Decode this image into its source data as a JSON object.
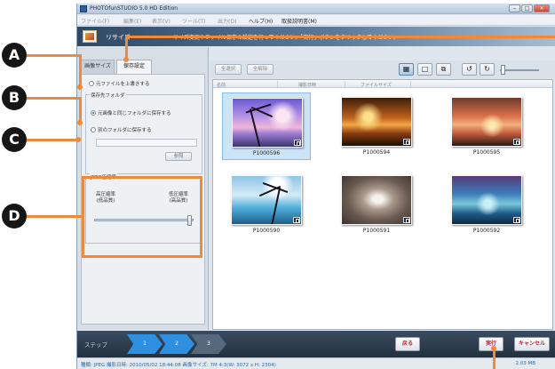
{
  "window": {
    "title": "PHOTOfunSTUDIO 5.0 HD Edition",
    "controls": [
      "–",
      "□",
      "×"
    ]
  },
  "menu": [
    {
      "label": "ファイル(F)",
      "active": false
    },
    {
      "label": "編集(E)",
      "active": false
    },
    {
      "label": "表示(V)",
      "active": false
    },
    {
      "label": "ツール(T)",
      "active": false
    },
    {
      "label": "出力(O)",
      "active": false
    },
    {
      "label": "ヘルプ(H)",
      "active": true
    },
    {
      "label": "取扱説明書(M)",
      "active": true
    }
  ],
  "header": {
    "title": "リサイズ",
    "description": "サイズ変更やファイル保存の設定を行ってください。「実行」ボタンをクリックしてください。"
  },
  "left_panel": {
    "tabs": [
      {
        "label": "画像サイズ",
        "selected": false
      },
      {
        "label": "保存設定",
        "selected": true
      }
    ],
    "overwrite_label": "元ファイルを上書きする",
    "save_folder_group": "保存先フォルダ",
    "same_folder_label": "元画像と同じフォルダに保存する",
    "other_folder_label": "別のフォルダに保存する",
    "browse_label": "参照",
    "jpeg_group": "JPEG圧縮率",
    "high_compression": "高圧縮率\n(低品質)",
    "low_compression": "低圧縮率\n(高品質)",
    "jpeg_slider_value_fraction": 0.96
  },
  "toolbar": {
    "select_all": "全選択",
    "deselect_all": "全解除",
    "view_buttons": [
      "▦",
      "□",
      "⧉"
    ],
    "rotate_buttons": [
      "↺",
      "↻"
    ],
    "zoom_slider_fraction": 0.1
  },
  "grid": {
    "columns": [
      "名前",
      "撮影日時",
      "ファイルサイズ"
    ],
    "files": [
      {
        "name": "P1000596",
        "selected": true
      },
      {
        "name": "P1000594",
        "selected": false
      },
      {
        "name": "P1000595",
        "selected": false
      },
      {
        "name": "P1000590",
        "selected": false
      },
      {
        "name": "P1000591",
        "selected": false
      },
      {
        "name": "P1000592",
        "selected": false
      }
    ]
  },
  "stepbar": {
    "label": "ステップ",
    "steps": [
      "1",
      "2",
      "3"
    ],
    "back_button": "戻る",
    "execute_button": "実行",
    "cancel_button": "キャンセル"
  },
  "status": {
    "info": "種類: JPEG  撮影日時: 2010/05/02 18:44:08  画像サイズ: 7M 4:3(W: 3072 x H: 2304)",
    "size": "2.03 MB"
  },
  "callouts": [
    "A",
    "B",
    "C",
    "D"
  ],
  "colors": {
    "accent": "#f08a3a",
    "callout_fill": "#161616",
    "selection": "#cde4f8",
    "status_text": "#2b6aa8",
    "action_text": "#c0243b"
  }
}
